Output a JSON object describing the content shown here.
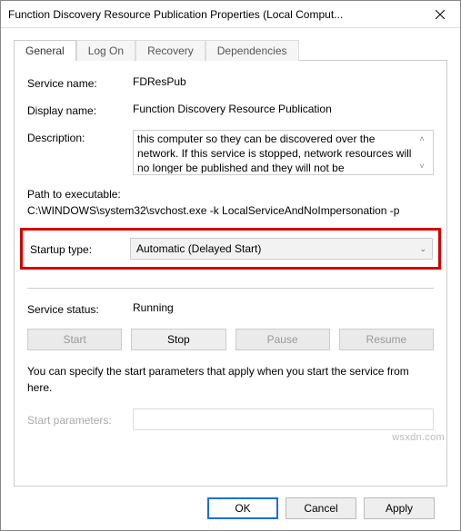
{
  "window": {
    "title": "Function Discovery Resource Publication Properties (Local Comput..."
  },
  "tabs": {
    "general": "General",
    "logon": "Log On",
    "recovery": "Recovery",
    "dependencies": "Dependencies"
  },
  "general": {
    "serviceNameLabel": "Service name:",
    "serviceName": "FDResPub",
    "displayNameLabel": "Display name:",
    "displayName": "Function Discovery Resource Publication",
    "descriptionLabel": "Description:",
    "description": "this computer so they can be discovered over the network.  If this service is stopped, network resources will no longer be published and they will not be",
    "pathLabel": "Path to executable:",
    "pathValue": "C:\\WINDOWS\\system32\\svchost.exe -k LocalServiceAndNoImpersonation -p",
    "startupTypeLabel": "Startup type:",
    "startupTypeValue": "Automatic (Delayed Start)",
    "serviceStatusLabel": "Service status:",
    "serviceStatus": "Running",
    "buttons": {
      "start": "Start",
      "stop": "Stop",
      "pause": "Pause",
      "resume": "Resume"
    },
    "hint": "You can specify the start parameters that apply when you start the service from here.",
    "startParamsLabel": "Start parameters:",
    "startParamsValue": ""
  },
  "footer": {
    "ok": "OK",
    "cancel": "Cancel",
    "apply": "Apply"
  },
  "watermark": "wsxdn.com"
}
